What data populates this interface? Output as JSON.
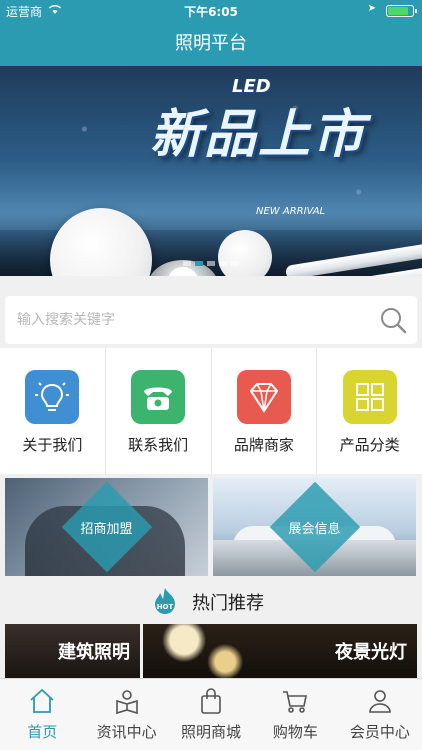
{
  "status_bar": {
    "carrier": "运营商",
    "time": "下午6:05",
    "battery_level": 0.85
  },
  "nav": {
    "title": "照明平台"
  },
  "banner": {
    "headline": "新品上市",
    "badge": "LED",
    "subtitle": "NEW ARRIVAL",
    "slide_count": 5,
    "active_slide": 1
  },
  "search": {
    "placeholder": "输入搜索关键字",
    "value": ""
  },
  "quick_menu": [
    {
      "label": "关于我们",
      "icon": "bulb-icon",
      "color": "#3f8fd2"
    },
    {
      "label": "联系我们",
      "icon": "phone-icon",
      "color": "#3db46d"
    },
    {
      "label": "品牌商家",
      "icon": "diamond-icon",
      "color": "#e85a4f"
    },
    {
      "label": "产品分类",
      "icon": "grid-icon",
      "color": "#d9d430"
    }
  ],
  "promos": [
    {
      "label": "招商加盟"
    },
    {
      "label": "展会信息"
    }
  ],
  "hot": {
    "badge": "HOT",
    "title": "热门推荐"
  },
  "features": [
    {
      "label": "建筑照明"
    },
    {
      "label": "夜景光灯"
    }
  ],
  "tabs": [
    {
      "label": "首页",
      "icon": "home-icon",
      "active": true
    },
    {
      "label": "资讯中心",
      "icon": "news-icon",
      "active": false
    },
    {
      "label": "照明商城",
      "icon": "shopping-bag-icon",
      "active": false
    },
    {
      "label": "购物车",
      "icon": "cart-icon",
      "active": false
    },
    {
      "label": "会员中心",
      "icon": "user-icon",
      "active": false
    }
  ],
  "colors": {
    "primary": "#2a9bb0",
    "tab_active": "#2a9bb0",
    "tab_inactive": "#444444"
  }
}
